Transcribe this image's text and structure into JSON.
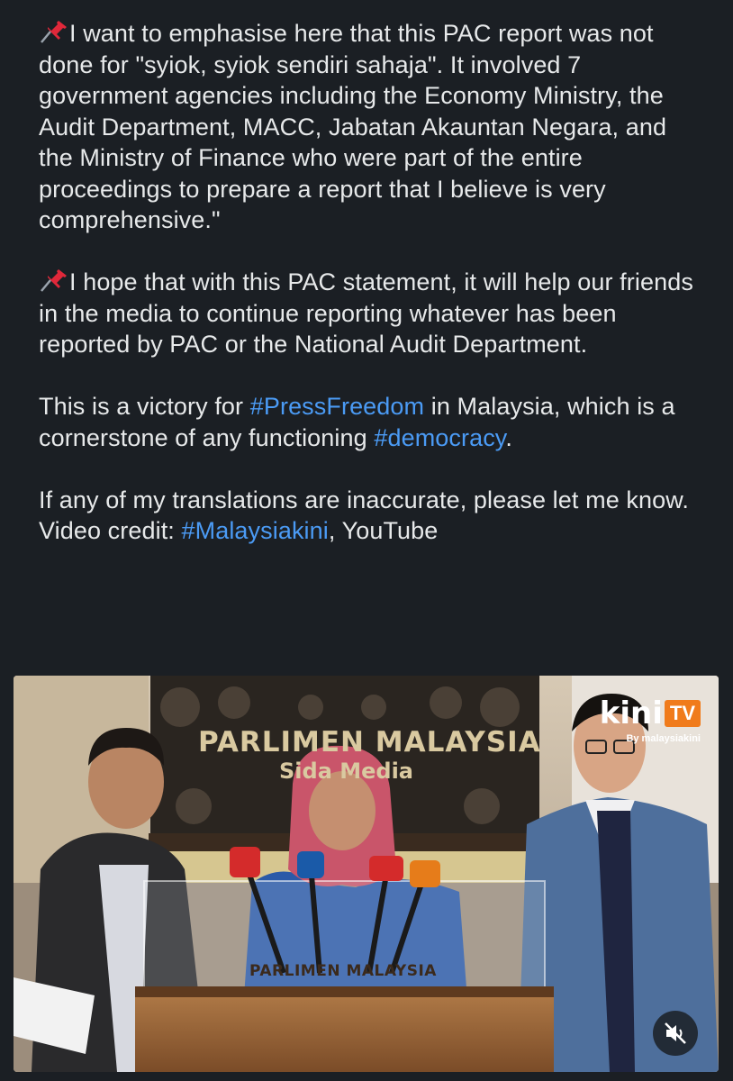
{
  "post": {
    "paragraph1": "I want to emphasise here that this PAC report was not done for \"syiok, syiok sendiri sahaja\". It involved 7 government agencies including the Economy Ministry, the Audit Department, MACC, Jabatan Akauntan Negara, and the Ministry of Finance who were part of the entire proceedings to prepare a report that I believe is very comprehensive.\"",
    "paragraph2": "I hope that with this PAC statement, it will help our friends in the media to continue reporting whatever has been reported by PAC or the National Audit Department.",
    "p3_prefix": "This is a victory for ",
    "p3_tag1": "#PressFreedom",
    "p3_middle": " in Malaysia, which is a cornerstone of any functioning ",
    "p3_tag2": "#democracy",
    "p3_suffix": ".",
    "paragraph4": "If any of my translations are inaccurate, please let me know.",
    "credit_prefix": "Video credit: ",
    "credit_tag": "#Malaysiakini",
    "credit_suffix": ", YouTube"
  },
  "video": {
    "backdrop_title": "PARLIMEN  MALAYSIA",
    "backdrop_sub": "Sida      Media",
    "podium_label": "PARLIMEN MALAYSIA",
    "logo_main": "kini",
    "logo_tv": "TV",
    "logo_by": "By malaysiakini",
    "mute_icon": "speaker-muted-icon"
  },
  "colors": {
    "background": "#1b1f24",
    "text": "#e7e9ea",
    "hashtag": "#4b9bf5",
    "kinitv_orange": "#f07b1b"
  }
}
